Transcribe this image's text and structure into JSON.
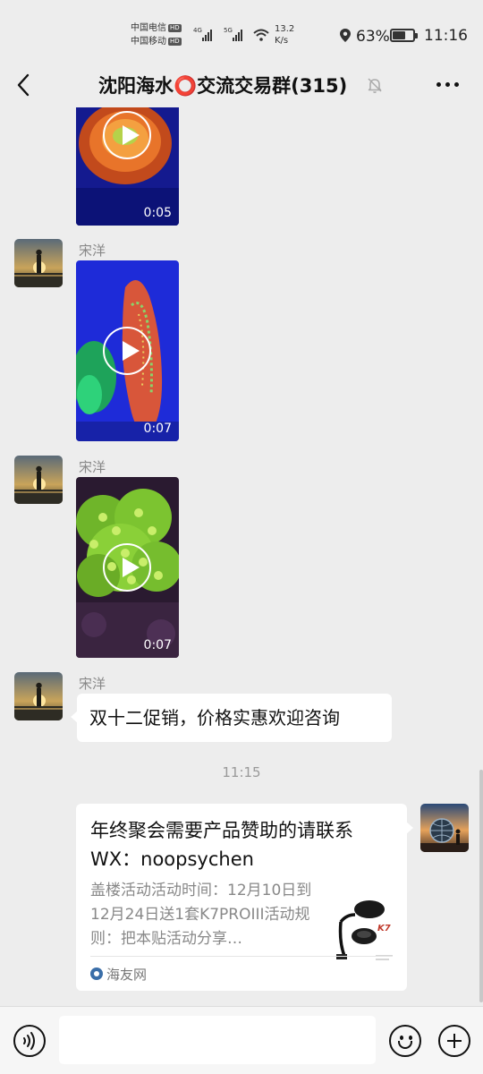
{
  "status_bar": {
    "carrier_1": "中国电信",
    "carrier_2": "中国移动",
    "hd_badge": "HD",
    "network_1": "4G",
    "network_2": "5G",
    "speed_value": "13.2",
    "speed_unit": "K/s",
    "battery_percent": "63%",
    "battery_level": 0.63,
    "time": "11:16"
  },
  "header": {
    "title": "沈阳海水⭕交流交易群(315)",
    "back_icon": "chevron-left-icon",
    "mute_icon": "bell-off-icon",
    "more_icon": "more-horizontal-icon"
  },
  "messages": [
    {
      "type": "video",
      "duration": "0:05"
    },
    {
      "type": "video",
      "sender": "宋洋",
      "duration": "0:07"
    },
    {
      "type": "video",
      "sender": "宋洋",
      "duration": "0:07"
    },
    {
      "type": "text",
      "sender": "宋洋",
      "text": "双十二促销，价格实惠欢迎咨询"
    }
  ],
  "time_separator": "11:15",
  "link_card": {
    "title": "年终聚会需要产品赞助的请联系WX：noopsychen",
    "description": "盖楼活动活动时间：12月10日到12月24日送1套K7PROIII活动规则：把本贴活动分享…",
    "source": "海友网",
    "thumb_brand": "K7"
  },
  "input_bar": {
    "placeholder": "",
    "voice_icon": "voice-icon",
    "emoji_icon": "emoji-icon",
    "plus_icon": "plus-circle-icon"
  },
  "colors": {
    "background": "#ededed",
    "bubble": "#ffffff",
    "meta_text": "#888888"
  }
}
